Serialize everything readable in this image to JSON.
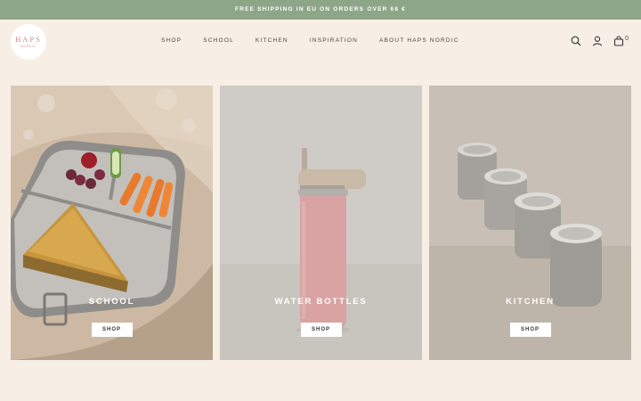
{
  "announcement": "FREE SHIPPING IN EU ON ORDERS OVER 68 €",
  "logo": {
    "main": "HAPS",
    "sub": "NORDIC"
  },
  "nav": [
    "SHOP",
    "SCHOOL",
    "KITCHEN",
    "INSPIRATION",
    "ABOUT HAPS NORDIC"
  ],
  "header_icons": [
    "search-icon",
    "account-icon",
    "cart-icon"
  ],
  "cart_count": "0",
  "tiles": [
    {
      "title": "SCHOOL",
      "button": "SHOP"
    },
    {
      "title": "WATER BOTTLES",
      "button": "SHOP"
    },
    {
      "title": "KITCHEN",
      "button": "SHOP"
    }
  ],
  "colors": {
    "announcement_bg": "#8ea688",
    "page_bg": "#f7efe5",
    "logo_text": "#c68c86"
  }
}
